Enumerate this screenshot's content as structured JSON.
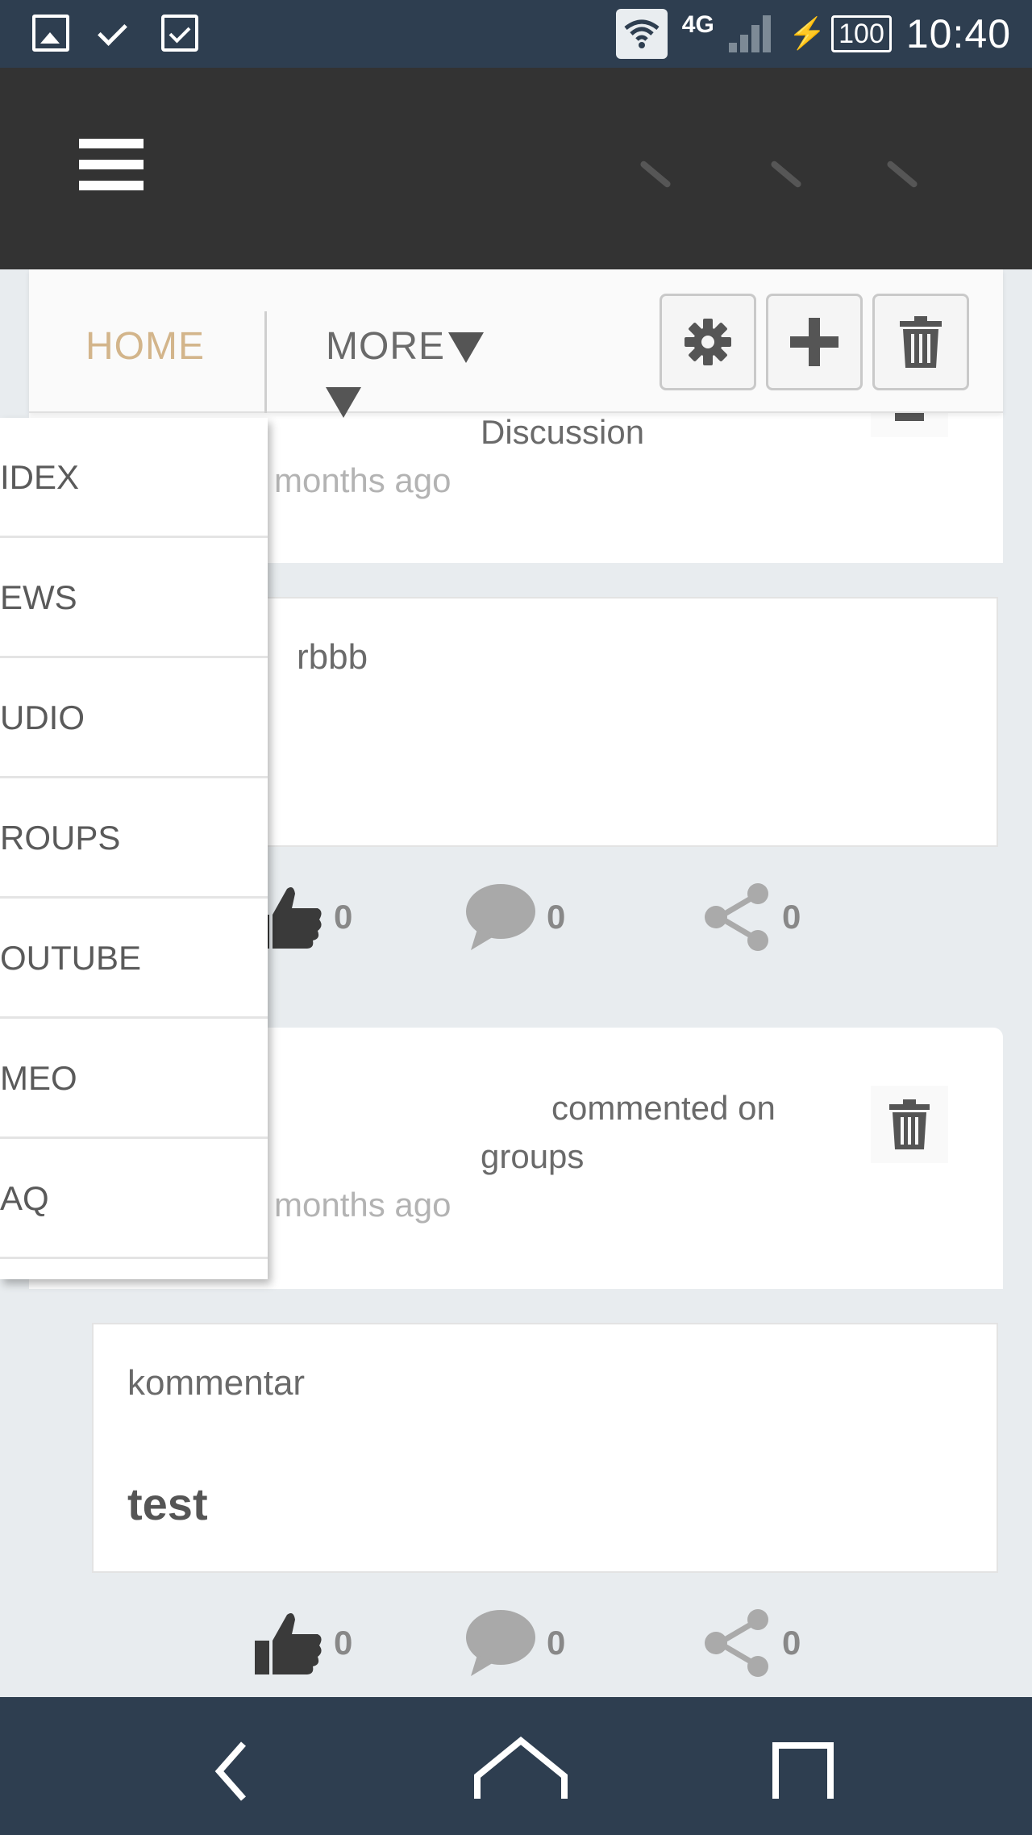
{
  "status_bar": {
    "left_icons": [
      "image-icon",
      "check-icon",
      "clipboard-check-icon"
    ],
    "network": "4G",
    "battery": "100",
    "time": "10:40"
  },
  "app_bar": {
    "menu_icon": "hamburger-icon"
  },
  "tabs": {
    "home": "HOME",
    "more": "MORE",
    "actions": [
      "settings-icon",
      "plus-icon",
      "trash-icon"
    ]
  },
  "dropdown": {
    "items": [
      "IDEX",
      "EWS",
      "UDIO",
      "ROUPS",
      "OUTUBE",
      "MEO",
      "AQ"
    ]
  },
  "feed": {
    "post1": {
      "meta": "Discussion",
      "time": "months ago",
      "content": "rbbb",
      "likes": "0",
      "comments": "0",
      "shares": "0"
    },
    "post2": {
      "meta_line1": "commented on",
      "meta_line2": "groups",
      "time": "months ago",
      "content_label": "kommentar",
      "content_bold": "test",
      "likes": "0",
      "comments": "0",
      "shares": "0"
    }
  },
  "colors": {
    "status_bar": "#2e3e50",
    "app_bar": "#333333",
    "home_tab": "#d3b58b",
    "background": "#e8ecef"
  }
}
